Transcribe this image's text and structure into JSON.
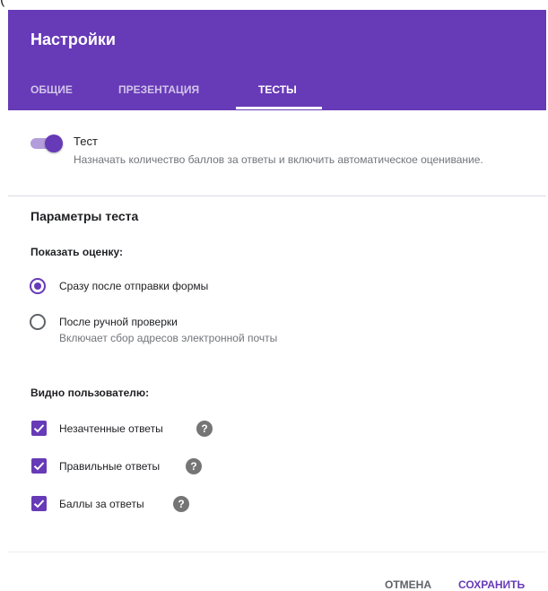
{
  "top_fragment": "(",
  "dialog": {
    "title": "Настройки",
    "tabs": [
      {
        "label": "Общие",
        "active": false
      },
      {
        "label": "Презентация",
        "active": false
      },
      {
        "label": "Тесты",
        "active": true
      }
    ]
  },
  "quiz_toggle": {
    "label": "Тест",
    "description": "Назначать количество баллов за ответы и включить автоматическое оценивание.",
    "enabled": true
  },
  "quiz_settings": {
    "section_title": "Параметры теста",
    "release_grade": {
      "title": "Показать оценку:",
      "options": [
        {
          "label": "Сразу после отправки формы",
          "checked": true
        },
        {
          "label": "После ручной проверки",
          "description": "Включает сбор адресов электронной почты",
          "checked": false
        }
      ]
    },
    "respondent_can_see": {
      "title": "Видно пользователю:",
      "options": [
        {
          "label": "Незачтенные ответы",
          "checked": true,
          "help_icon": "?"
        },
        {
          "label": "Правильные ответы",
          "checked": true,
          "help_icon": "?"
        },
        {
          "label": "Баллы за ответы",
          "checked": true,
          "help_icon": "?"
        }
      ]
    }
  },
  "actions": {
    "cancel_label": "Отмена",
    "save_label": "Сохранить"
  },
  "colors": {
    "accent": "#673ab7",
    "accent_light": "#b39ddb",
    "muted_text": "#70757a",
    "help_icon": "#757575"
  },
  "icons": {
    "radio_checked": "radio-button-checked-icon",
    "radio_unchecked": "radio-button-unchecked-icon",
    "checkbox": "check-icon",
    "help": "help-circle-icon"
  }
}
